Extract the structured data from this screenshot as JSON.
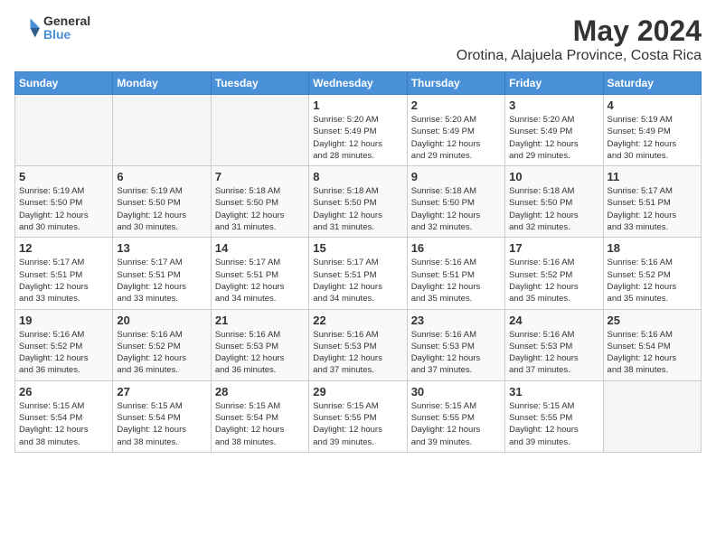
{
  "logo": {
    "general": "General",
    "blue": "Blue"
  },
  "title": "May 2024",
  "location": "Orotina, Alajuela Province, Costa Rica",
  "days_of_week": [
    "Sunday",
    "Monday",
    "Tuesday",
    "Wednesday",
    "Thursday",
    "Friday",
    "Saturday"
  ],
  "weeks": [
    [
      {
        "day": "",
        "info": ""
      },
      {
        "day": "",
        "info": ""
      },
      {
        "day": "",
        "info": ""
      },
      {
        "day": "1",
        "info": "Sunrise: 5:20 AM\nSunset: 5:49 PM\nDaylight: 12 hours\nand 28 minutes."
      },
      {
        "day": "2",
        "info": "Sunrise: 5:20 AM\nSunset: 5:49 PM\nDaylight: 12 hours\nand 29 minutes."
      },
      {
        "day": "3",
        "info": "Sunrise: 5:20 AM\nSunset: 5:49 PM\nDaylight: 12 hours\nand 29 minutes."
      },
      {
        "day": "4",
        "info": "Sunrise: 5:19 AM\nSunset: 5:49 PM\nDaylight: 12 hours\nand 30 minutes."
      }
    ],
    [
      {
        "day": "5",
        "info": "Sunrise: 5:19 AM\nSunset: 5:50 PM\nDaylight: 12 hours\nand 30 minutes."
      },
      {
        "day": "6",
        "info": "Sunrise: 5:19 AM\nSunset: 5:50 PM\nDaylight: 12 hours\nand 30 minutes."
      },
      {
        "day": "7",
        "info": "Sunrise: 5:18 AM\nSunset: 5:50 PM\nDaylight: 12 hours\nand 31 minutes."
      },
      {
        "day": "8",
        "info": "Sunrise: 5:18 AM\nSunset: 5:50 PM\nDaylight: 12 hours\nand 31 minutes."
      },
      {
        "day": "9",
        "info": "Sunrise: 5:18 AM\nSunset: 5:50 PM\nDaylight: 12 hours\nand 32 minutes."
      },
      {
        "day": "10",
        "info": "Sunrise: 5:18 AM\nSunset: 5:50 PM\nDaylight: 12 hours\nand 32 minutes."
      },
      {
        "day": "11",
        "info": "Sunrise: 5:17 AM\nSunset: 5:51 PM\nDaylight: 12 hours\nand 33 minutes."
      }
    ],
    [
      {
        "day": "12",
        "info": "Sunrise: 5:17 AM\nSunset: 5:51 PM\nDaylight: 12 hours\nand 33 minutes."
      },
      {
        "day": "13",
        "info": "Sunrise: 5:17 AM\nSunset: 5:51 PM\nDaylight: 12 hours\nand 33 minutes."
      },
      {
        "day": "14",
        "info": "Sunrise: 5:17 AM\nSunset: 5:51 PM\nDaylight: 12 hours\nand 34 minutes."
      },
      {
        "day": "15",
        "info": "Sunrise: 5:17 AM\nSunset: 5:51 PM\nDaylight: 12 hours\nand 34 minutes."
      },
      {
        "day": "16",
        "info": "Sunrise: 5:16 AM\nSunset: 5:51 PM\nDaylight: 12 hours\nand 35 minutes."
      },
      {
        "day": "17",
        "info": "Sunrise: 5:16 AM\nSunset: 5:52 PM\nDaylight: 12 hours\nand 35 minutes."
      },
      {
        "day": "18",
        "info": "Sunrise: 5:16 AM\nSunset: 5:52 PM\nDaylight: 12 hours\nand 35 minutes."
      }
    ],
    [
      {
        "day": "19",
        "info": "Sunrise: 5:16 AM\nSunset: 5:52 PM\nDaylight: 12 hours\nand 36 minutes."
      },
      {
        "day": "20",
        "info": "Sunrise: 5:16 AM\nSunset: 5:52 PM\nDaylight: 12 hours\nand 36 minutes."
      },
      {
        "day": "21",
        "info": "Sunrise: 5:16 AM\nSunset: 5:53 PM\nDaylight: 12 hours\nand 36 minutes."
      },
      {
        "day": "22",
        "info": "Sunrise: 5:16 AM\nSunset: 5:53 PM\nDaylight: 12 hours\nand 37 minutes."
      },
      {
        "day": "23",
        "info": "Sunrise: 5:16 AM\nSunset: 5:53 PM\nDaylight: 12 hours\nand 37 minutes."
      },
      {
        "day": "24",
        "info": "Sunrise: 5:16 AM\nSunset: 5:53 PM\nDaylight: 12 hours\nand 37 minutes."
      },
      {
        "day": "25",
        "info": "Sunrise: 5:16 AM\nSunset: 5:54 PM\nDaylight: 12 hours\nand 38 minutes."
      }
    ],
    [
      {
        "day": "26",
        "info": "Sunrise: 5:15 AM\nSunset: 5:54 PM\nDaylight: 12 hours\nand 38 minutes."
      },
      {
        "day": "27",
        "info": "Sunrise: 5:15 AM\nSunset: 5:54 PM\nDaylight: 12 hours\nand 38 minutes."
      },
      {
        "day": "28",
        "info": "Sunrise: 5:15 AM\nSunset: 5:54 PM\nDaylight: 12 hours\nand 38 minutes."
      },
      {
        "day": "29",
        "info": "Sunrise: 5:15 AM\nSunset: 5:55 PM\nDaylight: 12 hours\nand 39 minutes."
      },
      {
        "day": "30",
        "info": "Sunrise: 5:15 AM\nSunset: 5:55 PM\nDaylight: 12 hours\nand 39 minutes."
      },
      {
        "day": "31",
        "info": "Sunrise: 5:15 AM\nSunset: 5:55 PM\nDaylight: 12 hours\nand 39 minutes."
      },
      {
        "day": "",
        "info": ""
      }
    ]
  ]
}
